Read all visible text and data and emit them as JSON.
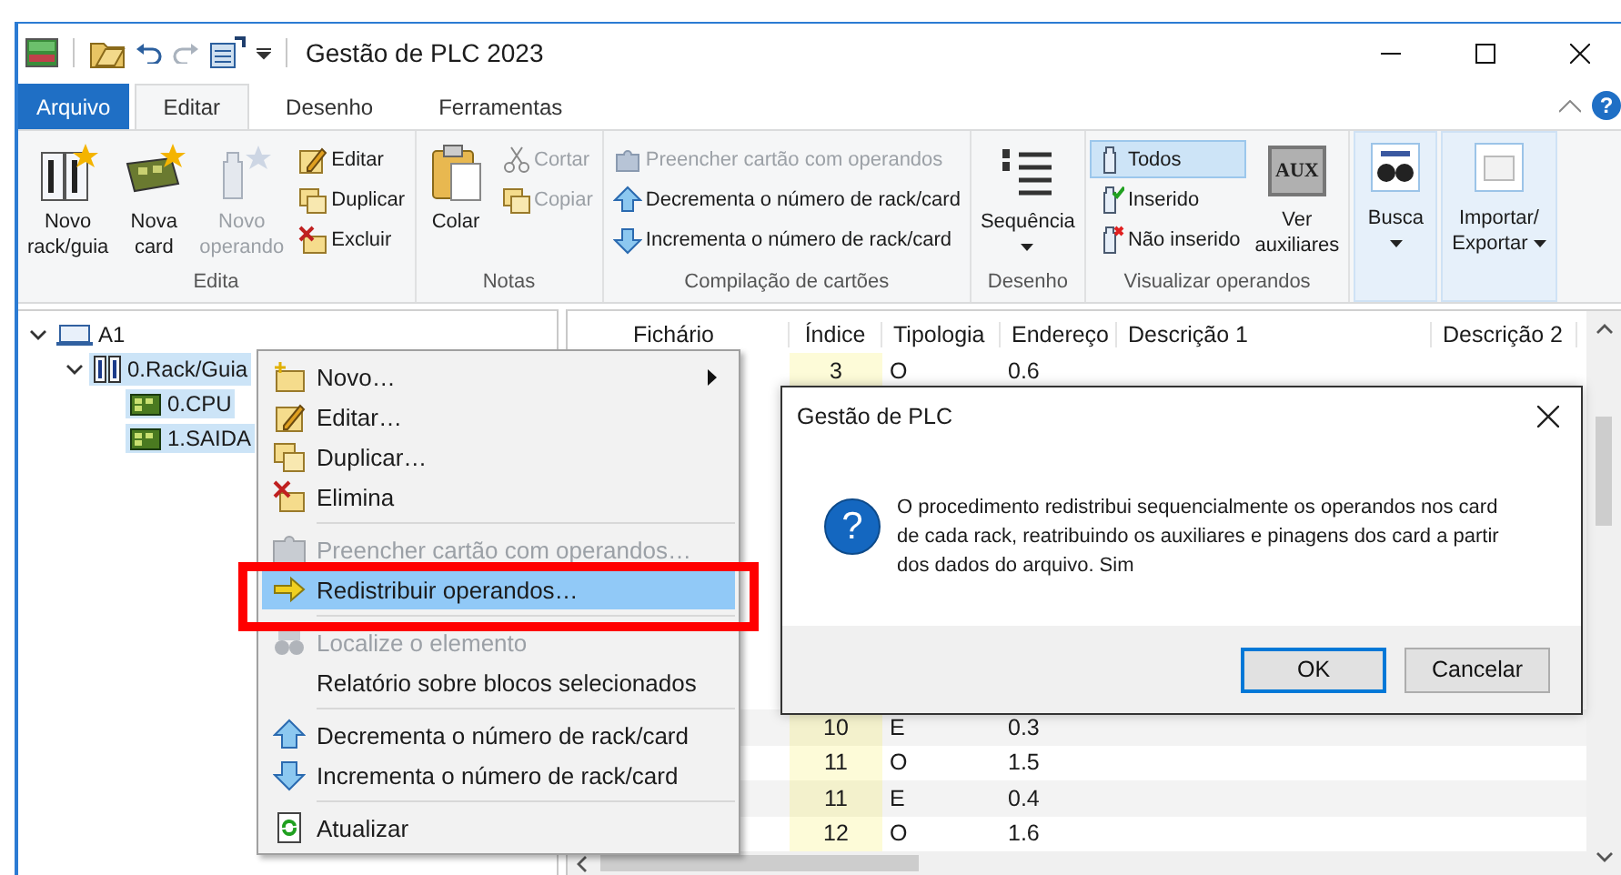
{
  "window": {
    "title": "Gestão de PLC 2023"
  },
  "ribbon_tabs": [
    {
      "label": "Arquivo",
      "kind": "file",
      "selected": false
    },
    {
      "label": "Editar",
      "kind": "tab",
      "selected": true
    },
    {
      "label": "Desenho",
      "kind": "tab",
      "selected": false
    },
    {
      "label": "Ferramentas",
      "kind": "tab",
      "selected": false
    }
  ],
  "help_button": "?",
  "ribbon": {
    "groups": [
      {
        "label": "Edita",
        "items": [
          {
            "kind": "large",
            "label": "Novo\nrack/guia",
            "disabled": false
          },
          {
            "kind": "large",
            "label": "Nova\ncard",
            "disabled": false
          },
          {
            "kind": "large",
            "label": "Novo\noperando",
            "disabled": true
          },
          {
            "kind": "small",
            "label": "Editar",
            "disabled": false
          },
          {
            "kind": "small",
            "label": "Duplicar",
            "disabled": false
          },
          {
            "kind": "small",
            "label": "Excluir",
            "disabled": false
          }
        ]
      },
      {
        "label": "Notas",
        "items": [
          {
            "kind": "large",
            "label": "Colar",
            "disabled": false
          },
          {
            "kind": "small",
            "label": "Cortar",
            "disabled": true
          },
          {
            "kind": "small",
            "label": "Copiar",
            "disabled": true
          }
        ]
      },
      {
        "label": "Compilação de cartões",
        "items": [
          {
            "kind": "small",
            "label": "Preencher cartão com operandos",
            "disabled": true
          },
          {
            "kind": "small",
            "label": "Decrementa o número de rack/card",
            "disabled": false
          },
          {
            "kind": "small",
            "label": "Incrementa o número de rack/card",
            "disabled": false
          }
        ]
      },
      {
        "label": "Desenho",
        "items": [
          {
            "kind": "large",
            "label": "Sequência",
            "disabled": false,
            "dropdown": true
          }
        ]
      },
      {
        "label": "Visualizar operandos",
        "items": [
          {
            "kind": "small",
            "label": "Todos",
            "disabled": false,
            "selected": true
          },
          {
            "kind": "small",
            "label": "Inserido",
            "disabled": false,
            "selected": false
          },
          {
            "kind": "small",
            "label": "Não inserido",
            "disabled": false,
            "selected": false
          },
          {
            "kind": "large",
            "label": "Ver\nauxiliares",
            "disabled": false,
            "badge": "AUX"
          }
        ]
      },
      {
        "items": [
          {
            "kind": "large",
            "label": "Busca",
            "disabled": false,
            "dropdown": true
          }
        ]
      },
      {
        "items": [
          {
            "kind": "large",
            "label": "Importar/\nExportar",
            "disabled": false,
            "dropdown": true
          }
        ]
      }
    ]
  },
  "tree": [
    {
      "label": "A1",
      "expanded": true,
      "selected": false,
      "children": [
        {
          "label": "0.Rack/Guia",
          "expanded": true,
          "selected": true,
          "children": [
            {
              "label": "0.CPU",
              "selected": true
            },
            {
              "label": "1.SAIDA",
              "selected": true
            }
          ]
        }
      ]
    }
  ],
  "table": {
    "columns": [
      "Fichário",
      "Índice",
      "Tipologia",
      "Endereço",
      "Descrição 1",
      "Descrição 2"
    ],
    "rows": [
      {
        "index": "3",
        "type": "O",
        "address": "0.6"
      },
      {
        "index": "10",
        "type": "E",
        "address": "0.3"
      },
      {
        "index": "11",
        "type": "O",
        "address": "1.5"
      },
      {
        "index": "11",
        "type": "E",
        "address": "0.4"
      },
      {
        "index": "12",
        "type": "O",
        "address": "1.6"
      }
    ]
  },
  "context_menu": [
    {
      "kind": "item",
      "label": "Novo…",
      "disabled": false,
      "selected": false,
      "submenu": true
    },
    {
      "kind": "item",
      "label": "Editar…",
      "disabled": false,
      "selected": false
    },
    {
      "kind": "item",
      "label": "Duplicar…",
      "disabled": false,
      "selected": false
    },
    {
      "kind": "item",
      "label": "Elimina",
      "disabled": false,
      "selected": false
    },
    {
      "kind": "separator"
    },
    {
      "kind": "item",
      "label": "Preencher cartão com operandos…",
      "disabled": true,
      "selected": false
    },
    {
      "kind": "item",
      "label": "Redistribuir operandos…",
      "disabled": false,
      "selected": true
    },
    {
      "kind": "separator"
    },
    {
      "kind": "item",
      "label": "Localize o elemento",
      "disabled": true,
      "selected": false
    },
    {
      "kind": "item",
      "label": "Relatório sobre blocos selecionados",
      "disabled": false,
      "selected": false
    },
    {
      "kind": "separator"
    },
    {
      "kind": "item",
      "label": "Decrementa o número de rack/card",
      "disabled": false,
      "selected": false
    },
    {
      "kind": "item",
      "label": "Incrementa o número de rack/card",
      "disabled": false,
      "selected": false
    },
    {
      "kind": "separator"
    },
    {
      "kind": "item",
      "label": "Atualizar",
      "disabled": false,
      "selected": false
    }
  ],
  "dialog": {
    "title": "Gestão de PLC",
    "icon_glyph": "?",
    "message": "O procedimento redistribui sequencialmente os operandos nos card de cada rack, reatribuindo os auxiliares e pinagens dos card a partir dos dados do arquivo. Sim",
    "buttons": [
      {
        "label": "OK",
        "default": true
      },
      {
        "label": "Cancelar",
        "default": false
      }
    ]
  }
}
